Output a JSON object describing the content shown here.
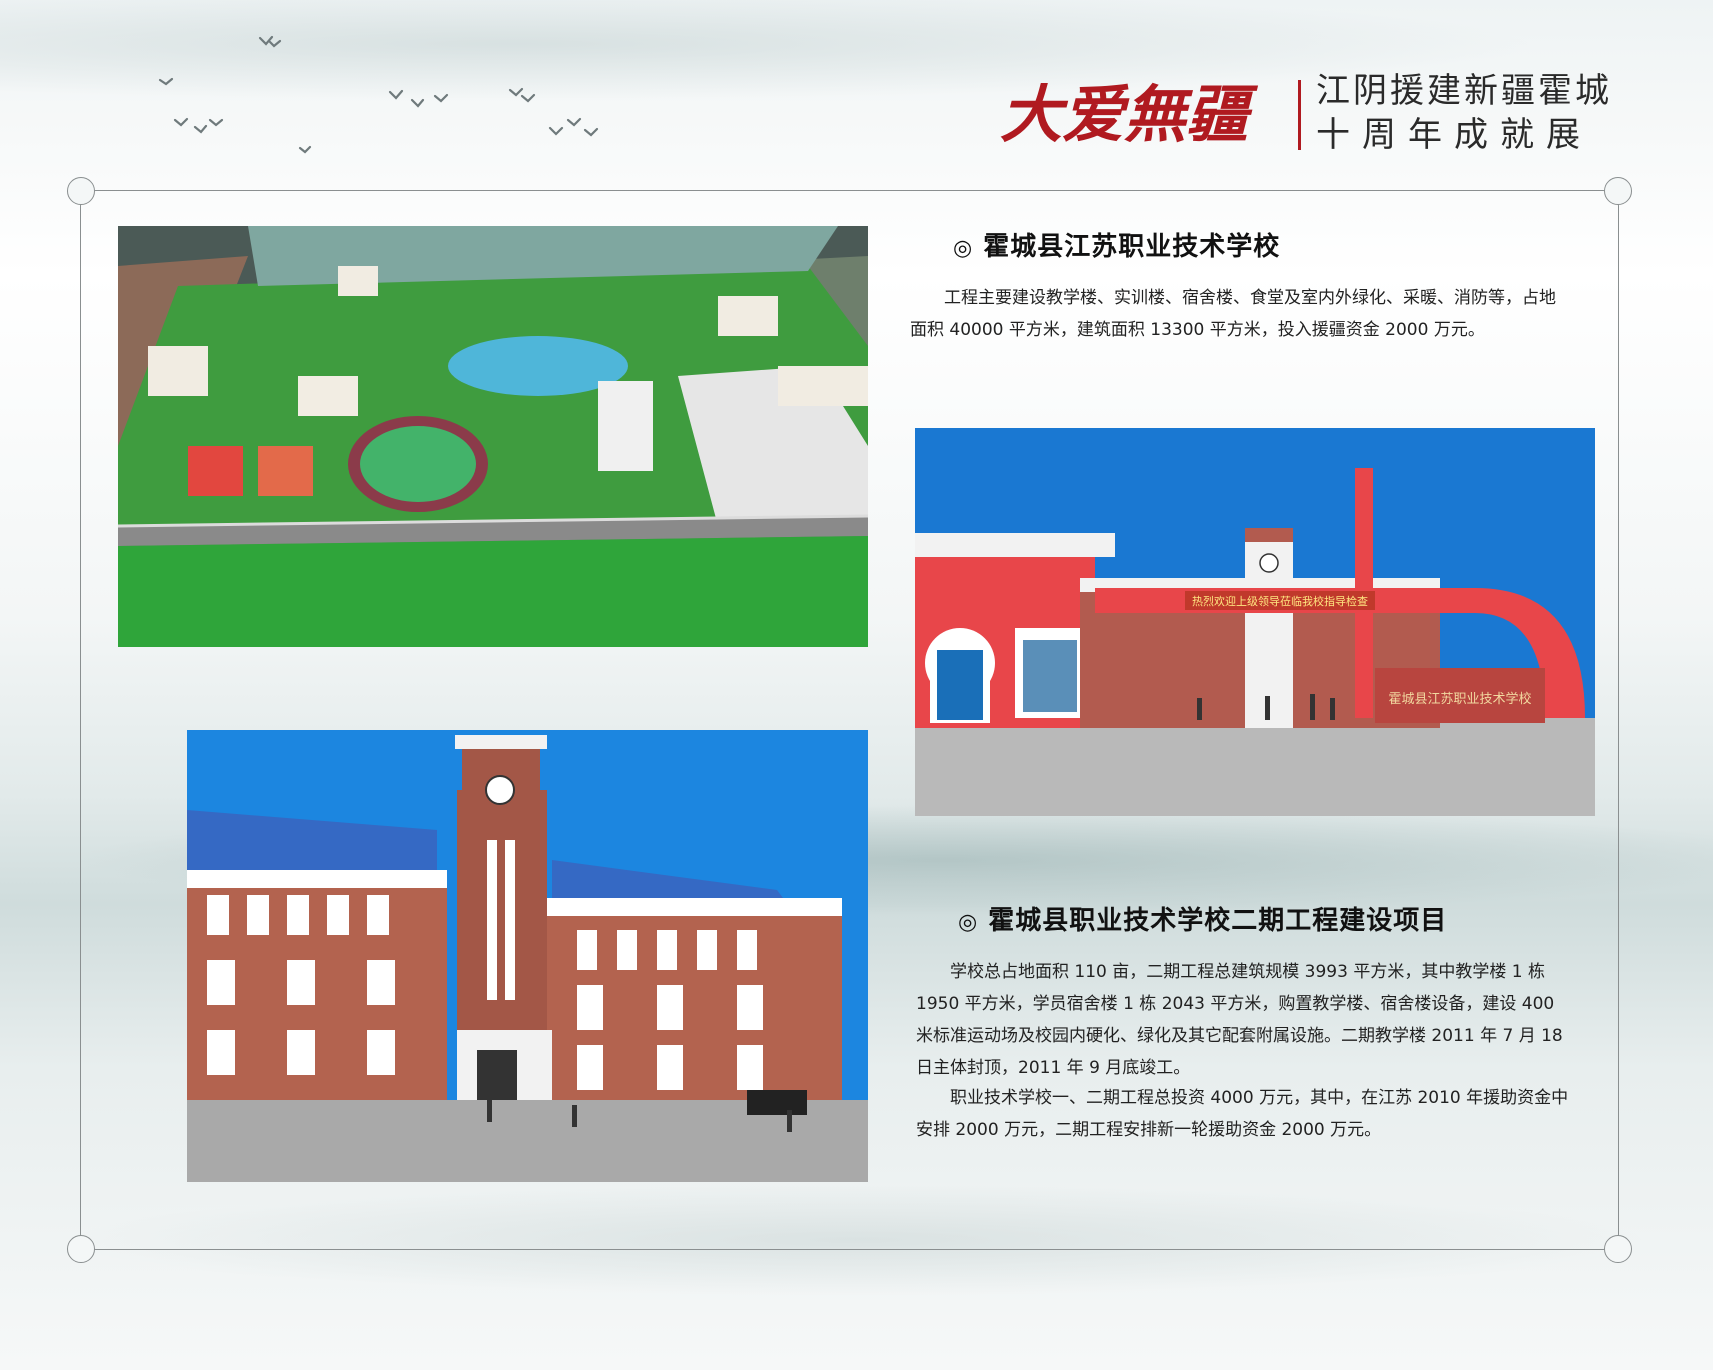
{
  "header": {
    "brand_text": "大爱無疆",
    "subtitle_line1": "江阴援建新疆霍城",
    "subtitle_line2": "十周年成就展"
  },
  "sections": [
    {
      "title_mark": "◎",
      "title": "霍城县江苏职业技术学校",
      "paragraphs": [
        "工程主要建设教学楼、实训楼、宿舍楼、食堂及室内外绿化、采暖、消防等，占地面积 40000 平方米，建筑面积 13300 平方米，投入援疆资金 2000 万元。"
      ]
    },
    {
      "title_mark": "◎",
      "title": "霍城县职业技术学校二期工程建设项目",
      "paragraphs": [
        "学校总占地面积 110 亩，二期工程总建筑规模 3993 平方米，其中教学楼 1 栋 1950 平方米，学员宿舍楼 1 栋 2043 平方米，购置教学楼、宿舍楼设备，建设 400 米标准运动场及校园内硬化、绿化及其它配套附属设施。二期教学楼 2011 年 7 月 18 日主体封顶，2011 年 9 月底竣工。",
        "职业技术学校一、二期工程总投资 4000 万元，其中，在江苏 2010 年援助资金中安排 2000 万元，二期工程安排新一轮援助资金 2000 万元。"
      ]
    }
  ],
  "photos": {
    "gate_banner": "热烈欢迎上级领导莅临我校指导检查",
    "gate_sign": "霍城县江苏职业技术学校"
  },
  "colors": {
    "brand_red": "#b01a20",
    "frame_line": "#8a8f90"
  }
}
